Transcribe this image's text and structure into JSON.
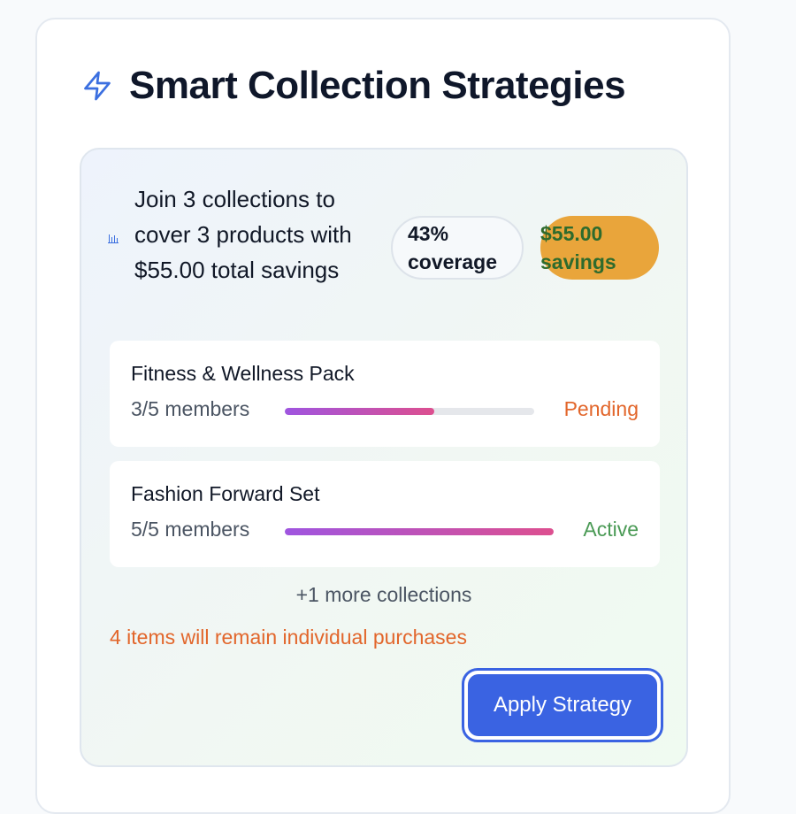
{
  "header": {
    "title": "Smart Collection Strategies",
    "icon": "lightning-bolt-icon"
  },
  "summary": {
    "text": "Join 3 collections to cover 3 products with $55.00 total savings",
    "icon": "bar-chart-icon",
    "coverage_label": "43% coverage",
    "coverage_fraction": 0.43,
    "savings_label": "$55.00 savings"
  },
  "collections": [
    {
      "name": "Fitness & Wellness Pack",
      "members_label": "3/5 members",
      "members_current": 3,
      "members_total": 5,
      "status": "Pending",
      "status_color": "#e2662b"
    },
    {
      "name": "Fashion Forward Set",
      "members_label": "5/5 members",
      "members_current": 5,
      "members_total": 5,
      "status": "Active",
      "status_color": "#4a9a55"
    }
  ],
  "more_collections": "+1 more collections",
  "remaining_note": "4 items will remain individual purchases",
  "actions": {
    "apply_label": "Apply Strategy"
  },
  "colors": {
    "accent": "#3a63e2",
    "savings_bg": "#e9a53b",
    "savings_text": "#2e6b2d",
    "warning": "#e2662b",
    "success": "#4a9a55",
    "progress_start": "#9f55e0",
    "progress_end": "#dd4f8f"
  }
}
